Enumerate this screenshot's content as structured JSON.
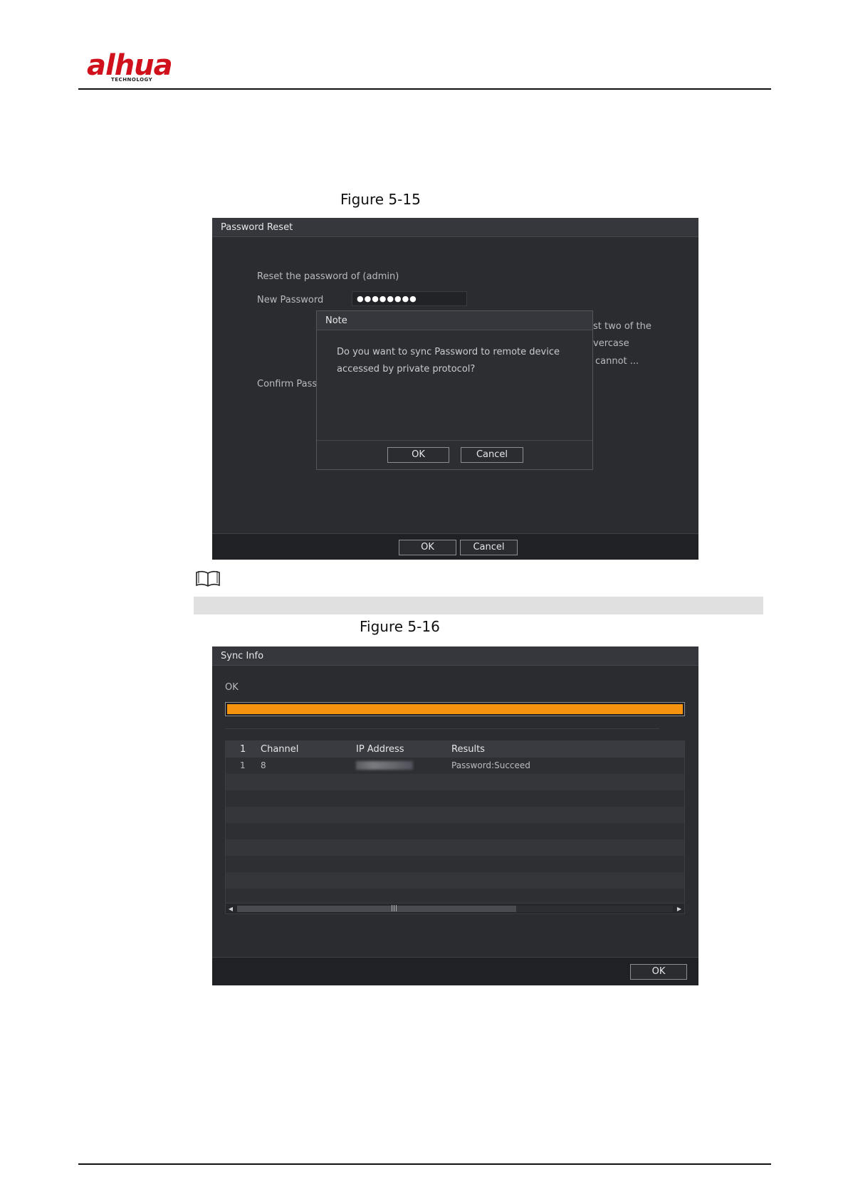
{
  "doc": {
    "logo_text": "alhua",
    "logo_sub": "TECHNOLOGY",
    "caption_1": "Figure 5-15",
    "caption_2": "Figure 5-16"
  },
  "password_reset": {
    "title": "Password Reset",
    "reset_label": "Reset the password of (admin)",
    "new_password_label": "New Password",
    "new_password_value": "●●●●●●●●",
    "hint_line1": "st two of the",
    "hint_line2": "vercase",
    "hint_line3": "cannot ...",
    "confirm_label": "Confirm Pass",
    "ok_label": "OK",
    "cancel_label": "Cancel"
  },
  "note_dialog": {
    "title": "Note",
    "message": "Do you want to sync Password to remote device accessed by private protocol?",
    "ok_label": "OK",
    "cancel_label": "Cancel"
  },
  "sync_info": {
    "title": "Sync Info",
    "status": "OK",
    "progress": 1.0,
    "progress_color": "#f5930f",
    "columns": [
      "1",
      "Channel",
      "IP Address",
      "Results"
    ],
    "rows": [
      {
        "index": "1",
        "channel": "8",
        "ip": "",
        "result": "Password:Succeed"
      }
    ],
    "ok_label": "OK"
  },
  "colors": {
    "window_bg": "#2b2c30",
    "title_bg": "#36373c",
    "brand_red": "#d0101b"
  }
}
